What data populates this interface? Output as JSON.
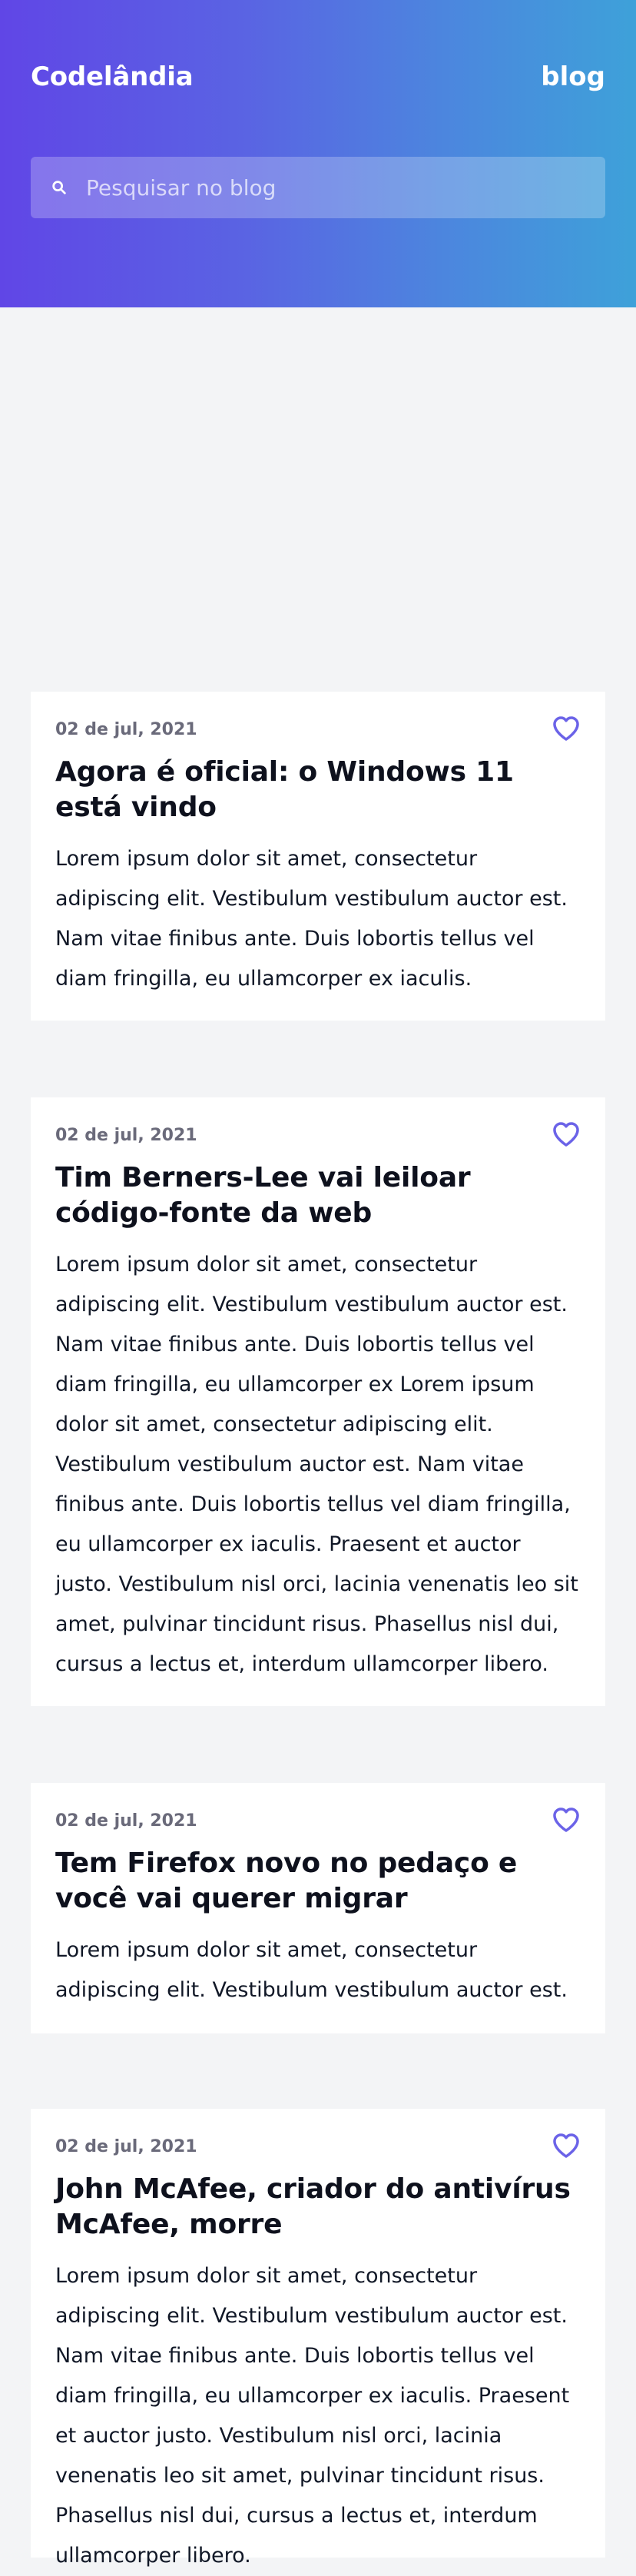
{
  "header": {
    "brand": "Codelândia",
    "nav_link": "blog",
    "search_placeholder": "Pesquisar no blog",
    "search_icon": "search-icon",
    "gradient_start": "#6046e6",
    "gradient_end": "#3ea1d9"
  },
  "posts": [
    {
      "date": "02 de jul, 2021",
      "title": "Agora é oficial: o Windows 11 está vindo",
      "excerpt": "Lorem ipsum dolor sit amet, consectetur adipiscing elit. Vestibulum vestibulum auctor est. Nam vitae finibus ante. Duis lobortis tellus vel diam fringilla, eu ullamcorper ex iaculis.",
      "like_icon": "heart-icon"
    },
    {
      "date": "02 de jul, 2021",
      "title": "Tim Berners-Lee vai leiloar código-fonte da web",
      "excerpt": "Lorem ipsum dolor sit amet, consectetur adipiscing elit. Vestibulum vestibulum auctor est. Nam vitae finibus ante. Duis lobortis tellus vel diam fringilla, eu ullamcorper ex Lorem ipsum dolor sit amet, consectetur adipiscing elit. Vestibulum vestibulum auctor est. Nam vitae finibus ante. Duis lobortis tellus vel diam fringilla, eu ullamcorper ex iaculis. Praesent et auctor justo. Vestibulum nisl orci, lacinia venenatis leo sit amet, pulvinar tincidunt risus. Phasellus nisl dui, cursus a lectus et, interdum ullamcorper libero.",
      "like_icon": "heart-icon"
    },
    {
      "date": "02 de jul, 2021",
      "title": "Tem Firefox novo no pedaço e você vai querer migrar",
      "excerpt": "Lorem ipsum dolor sit amet, consectetur adipiscing elit. Vestibulum vestibulum auctor est.",
      "like_icon": "heart-icon"
    },
    {
      "date": "02 de jul, 2021",
      "title": "John McAfee, criador do antivírus McAfee, morre",
      "excerpt": "Lorem ipsum dolor sit amet, consectetur adipiscing elit. Vestibulum vestibulum auctor est. Nam vitae finibus ante. Duis lobortis tellus vel diam fringilla, eu ullamcorper ex iaculis. Praesent et auctor justo. Vestibulum nisl orci, lacinia venenatis leo sit amet, pulvinar tincidunt risus. Phasellus nisl dui, cursus a lectus et, interdum ullamcorper libero.",
      "like_icon": "heart-icon"
    }
  ],
  "colors": {
    "accent": "#6b63e8",
    "background": "#f3f4f6",
    "card": "#ffffff",
    "meta_text": "#6a6a7a",
    "body_text": "#111827"
  }
}
